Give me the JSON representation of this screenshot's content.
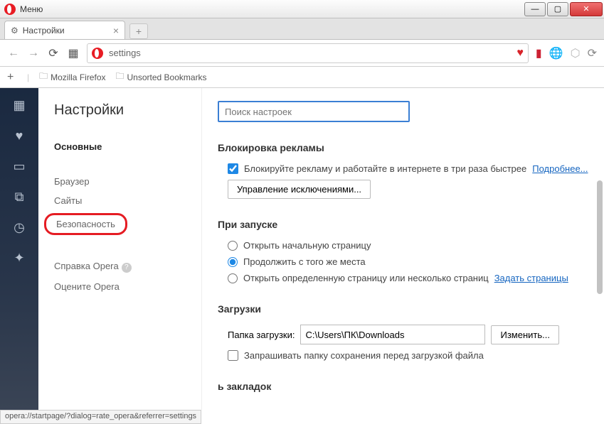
{
  "titlebar": {
    "menu": "Меню"
  },
  "tab": {
    "title": "Настройки"
  },
  "addressbar": {
    "value": "settings"
  },
  "bookmarks": {
    "f1": "Mozilla Firefox",
    "f2": "Unsorted Bookmarks"
  },
  "sidebar": {
    "title": "Настройки",
    "main": "Основные",
    "browser": "Браузер",
    "sites": "Сайты",
    "security": "Безопасность",
    "help": "Справка Opera",
    "rate": "Оцените Opera"
  },
  "search": {
    "placeholder": "Поиск настроек"
  },
  "adblock": {
    "heading": "Блокировка рекламы",
    "checkbox_label": "Блокируйте рекламу и работайте в интернете в три раза быстрее",
    "more": "Подробнее...",
    "manage": "Управление исключениями..."
  },
  "startup": {
    "heading": "При запуске",
    "opt1": "Открыть начальную страницу",
    "opt2": "Продолжить с того же места",
    "opt3": "Открыть определенную страницу или несколько страниц",
    "set_pages": "Задать страницы"
  },
  "downloads": {
    "heading": "Загрузки",
    "folder_label": "Папка загрузки:",
    "folder_value": "C:\\Users\\ПК\\Downloads",
    "change": "Изменить...",
    "ask": "Запрашивать папку сохранения перед загрузкой файла"
  },
  "bookmarks_section": {
    "heading": "ь закладок"
  },
  "status": "opera://startpage/?dialog=rate_opera&referrer=settings"
}
